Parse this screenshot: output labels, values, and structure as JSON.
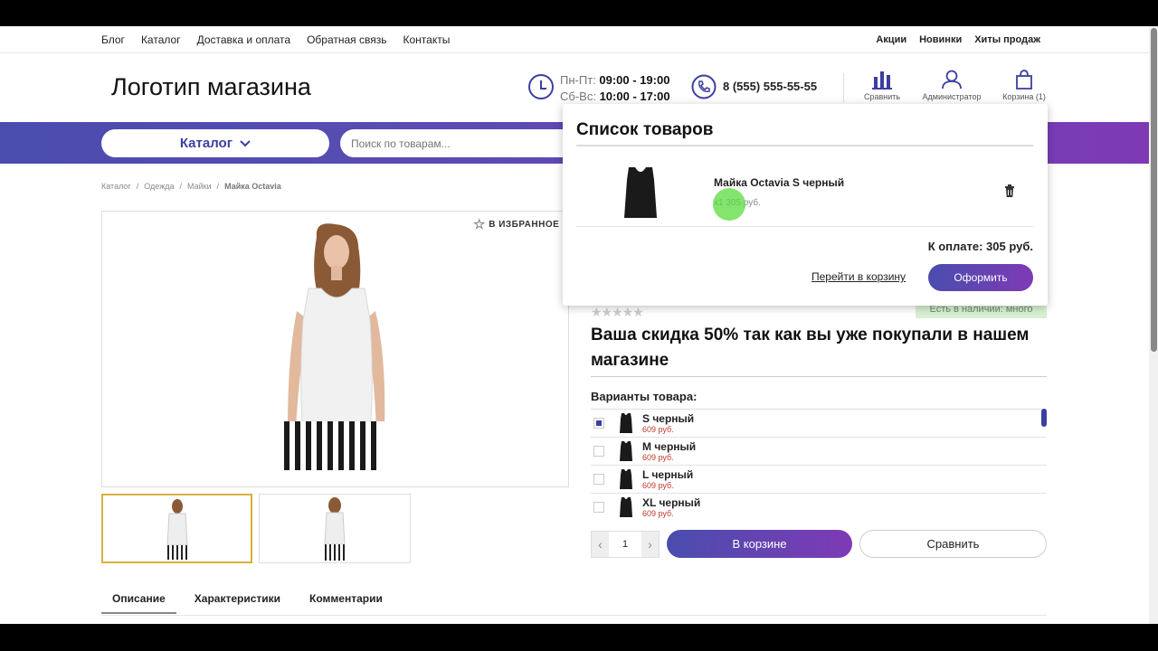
{
  "top_nav": {
    "left": [
      "Блог",
      "Каталог",
      "Доставка и оплата",
      "Обратная связь",
      "Контакты"
    ],
    "right": [
      "Акции",
      "Новинки",
      "Хиты продаж"
    ]
  },
  "header": {
    "logo": "Логотип магазина",
    "hours_weekday_label": "Пн-Пт:",
    "hours_weekday": "09:00 - 19:00",
    "hours_weekend_label": "Сб-Вс:",
    "hours_weekend": "10:00 - 17:00",
    "phone": "8 (555) 555-55-55",
    "compare_label": "Сравнить",
    "account_label": "Администратор",
    "cart_label": "Корзина (1)"
  },
  "catalog_button": "Каталог",
  "search": {
    "placeholder": "Поиск по товарам..."
  },
  "breadcrumbs": [
    "Каталог",
    "Одежда",
    "Майки",
    "Майка Octavia"
  ],
  "favorite_label": "В ИЗБРАННОЕ",
  "tabs": [
    "Описание",
    "Характеристики",
    "Комментарии"
  ],
  "product": {
    "stock": "Есть в наличии: много",
    "promo": "Ваша скидка 50% так как вы уже покупали в нашем магазине",
    "variants_label": "Варианты товара:",
    "variants": [
      {
        "name": "S черный",
        "price": "609 руб.",
        "selected": true
      },
      {
        "name": "M черный",
        "price": "609 руб.",
        "selected": false
      },
      {
        "name": "L черный",
        "price": "609 руб.",
        "selected": false
      },
      {
        "name": "XL черный",
        "price": "609 руб.",
        "selected": false
      }
    ],
    "quantity": "1",
    "cart_button": "В корзине",
    "compare_button": "Сравнить"
  },
  "cart_popup": {
    "title": "Список товаров",
    "item_name": "Майка Octavia S черный",
    "item_qty": "x1 305 руб.",
    "total": "К оплате: 305 руб.",
    "go_to_cart": "Перейти в корзину",
    "checkout": "Оформить"
  },
  "colors": {
    "accent": "#3b3fa0",
    "accent2": "#7e3ab5",
    "thumb_border": "#d7b23a"
  }
}
